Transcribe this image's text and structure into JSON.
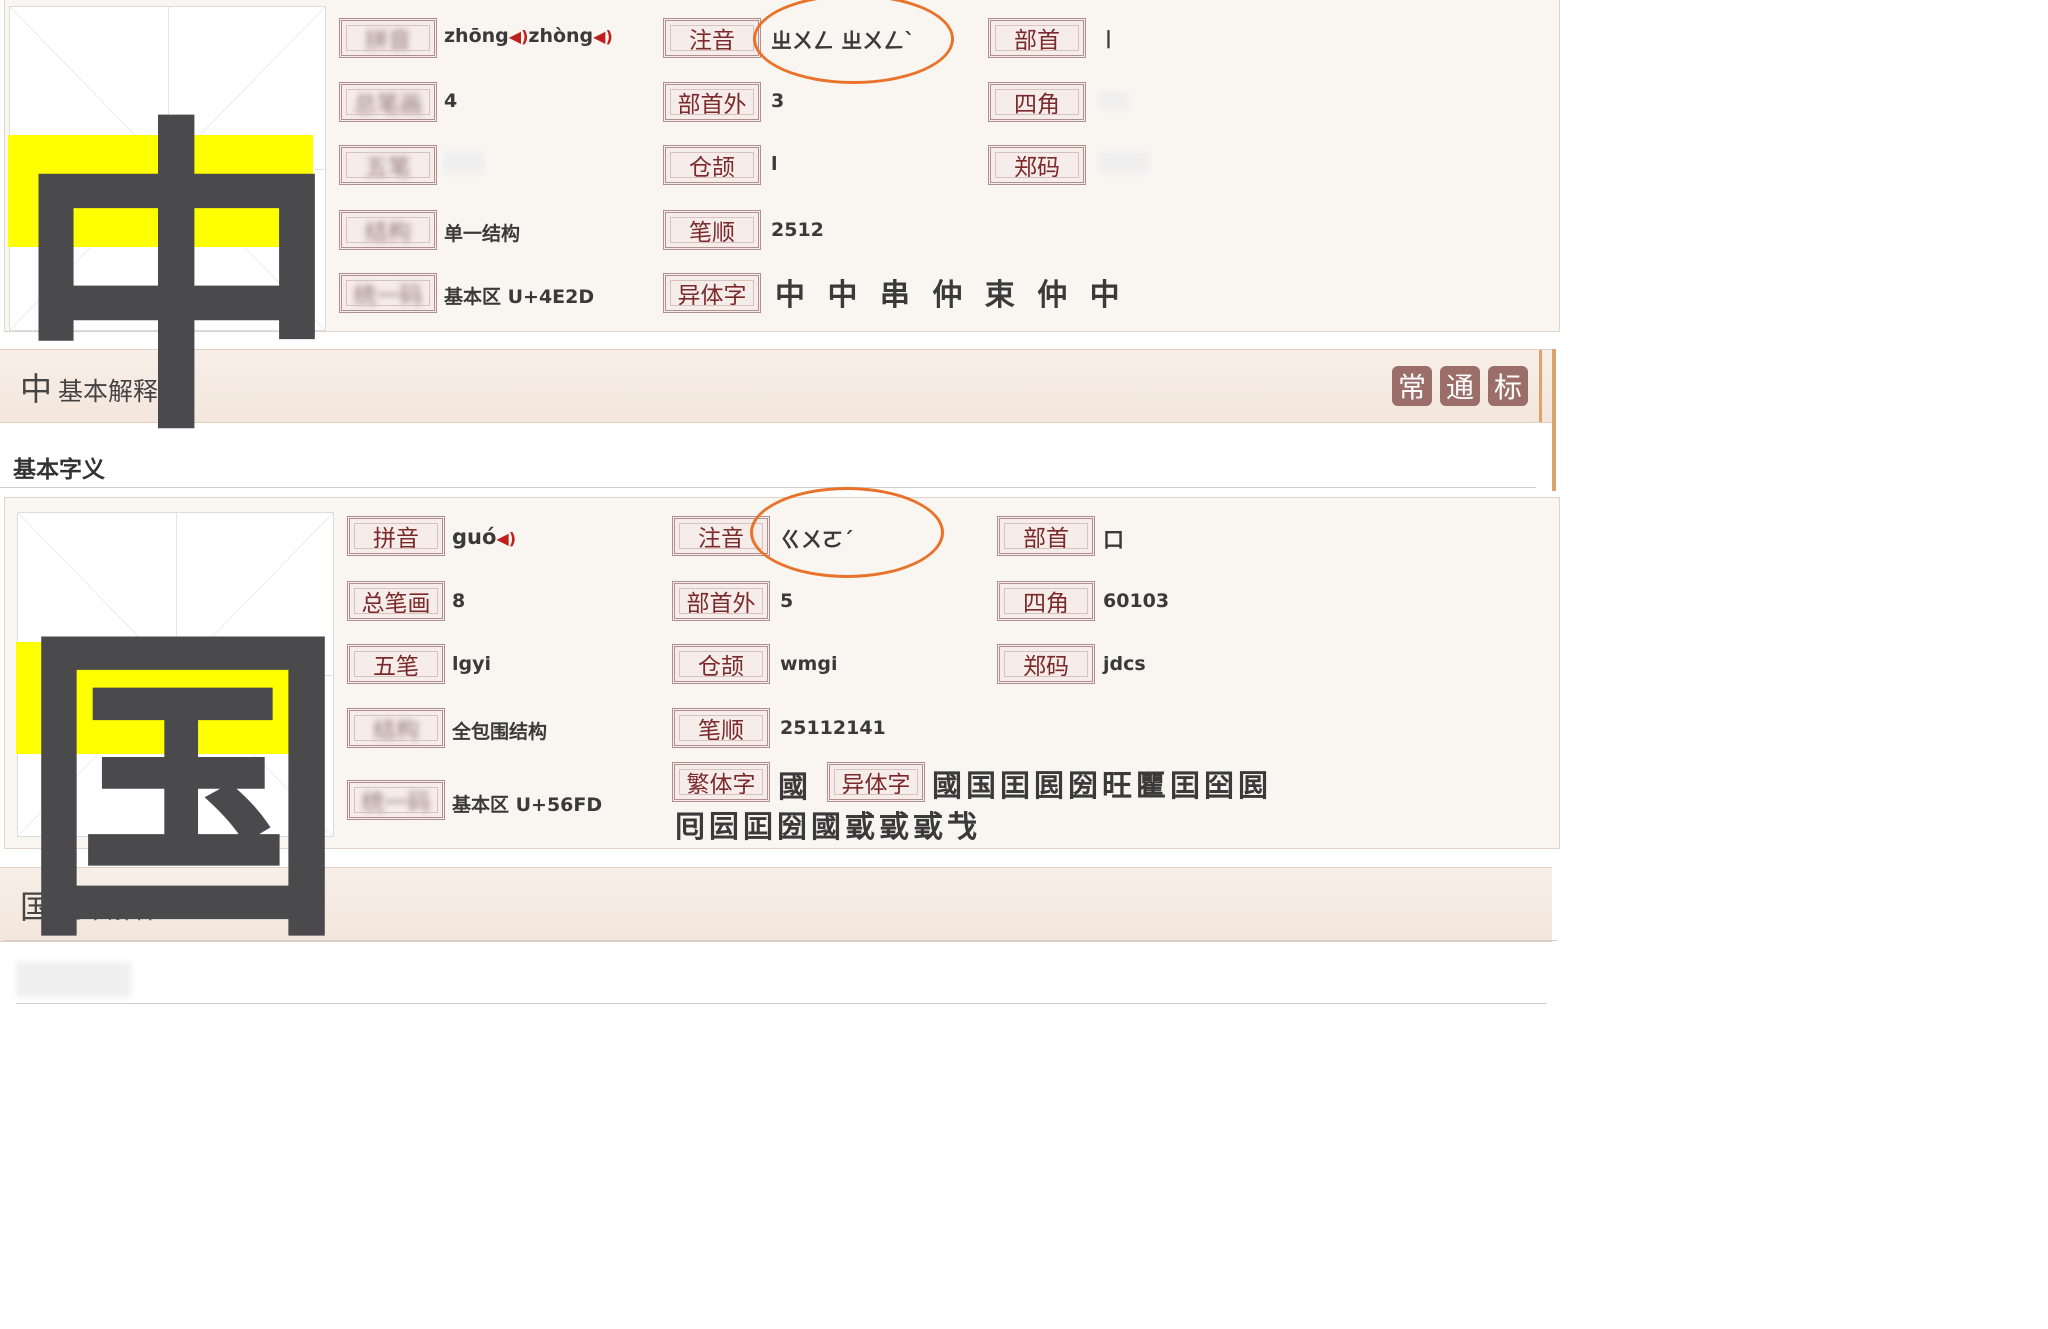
{
  "char1": {
    "char": "中",
    "pinyin": "zhōng",
    "pinyin2": "zhòng",
    "zhuyin_label": "注音",
    "zhuyin": "ㄓㄨㄥ ㄓㄨㄥˋ",
    "radical_label": "部首",
    "radical": "丨",
    "strokes": "4",
    "extra_strokes_label": "部首外",
    "extra_strokes": "3",
    "four_corner_label": "四角",
    "cangjie_label": "仓颉",
    "cangjie": "l",
    "zhengma_label": "郑码",
    "structure": "单一结构",
    "stroke_order_label": "笔顺",
    "stroke_order": "2512",
    "unicode": "基本区 U+4E2D",
    "variants_label": "异体字",
    "variants": "中 中 串 仲 束 仲 中",
    "section_title": "基本解释",
    "badges": [
      "常",
      "通",
      "标"
    ],
    "subheading": "基本字义"
  },
  "char2": {
    "char": "国",
    "pinyin_label": "拼音",
    "pinyin": "guó",
    "zhuyin_label": "注音",
    "zhuyin": "ㄍㄨㄛˊ",
    "radical_label": "部首",
    "radical": "口",
    "strokes_label": "总笔画",
    "strokes": "8",
    "extra_strokes_label": "部首外",
    "extra_strokes": "5",
    "four_corner_label": "四角",
    "four_corner": "60103",
    "wubi_label": "五笔",
    "wubi": "lgyi",
    "cangjie_label": "仓颉",
    "cangjie": "wmgi",
    "zhengma_label": "郑码",
    "zhengma": "jdcs",
    "structure": "全包围结构",
    "stroke_order_label": "笔顺",
    "stroke_order": "25112141",
    "unicode": "基本区 U+56FD",
    "traditional_label": "繁体字",
    "traditional": "國",
    "variants_label": "异体字",
    "variants_line1": "國国囯囻圀旺匷囯囶囻",
    "variants_line2": "囘囩囸圀國戜戜戜𢦏",
    "section_title": "基本解释"
  }
}
